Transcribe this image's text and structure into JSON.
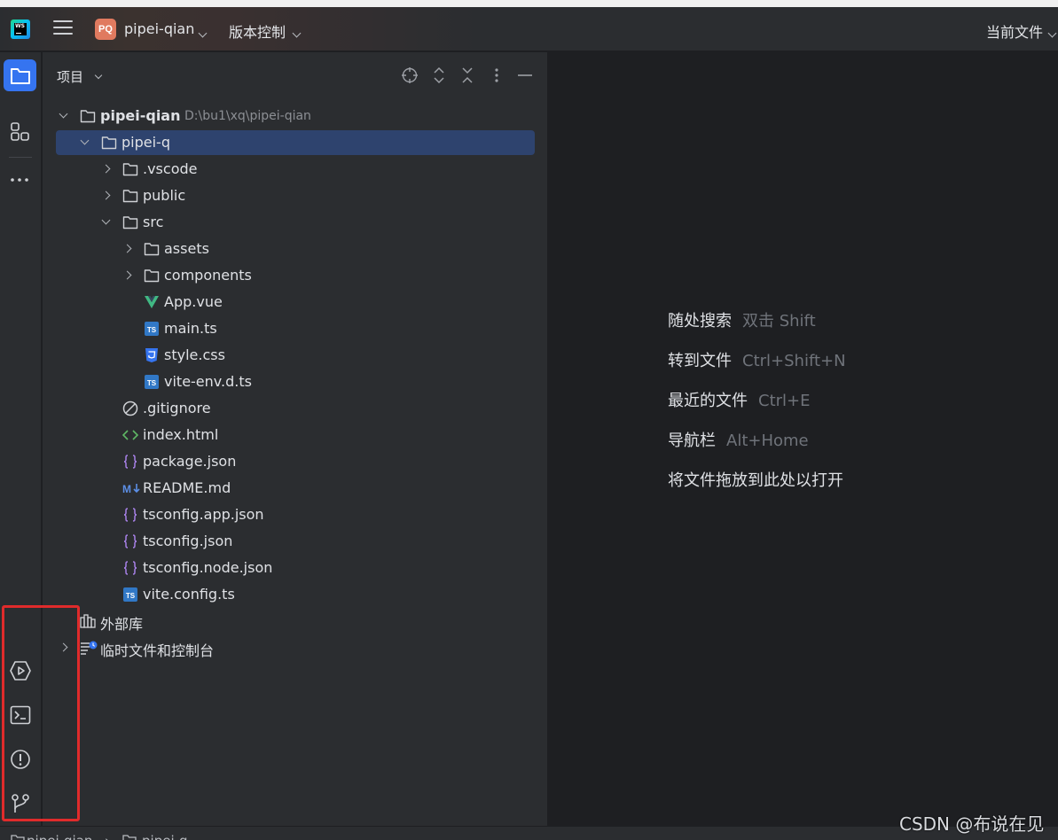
{
  "titlebar": {
    "logo_text": "WS",
    "project_badge": "PQ",
    "project_name": "pipei-qian",
    "vcs_label": "版本控制",
    "current_file_label": "当前文件"
  },
  "panel": {
    "title": "项目"
  },
  "tree": [
    {
      "label": "pipei-qian",
      "path": "D:\\bu1\\xq\\pipei-qian",
      "icon": "folder-icon",
      "depth": 0,
      "arrow": "down",
      "bold": true
    },
    {
      "label": "pipei-q",
      "icon": "folder-icon",
      "depth": 1,
      "arrow": "down",
      "selected": true
    },
    {
      "label": ".vscode",
      "icon": "folder-icon",
      "depth": 2,
      "arrow": "right"
    },
    {
      "label": "public",
      "icon": "folder-icon",
      "depth": 2,
      "arrow": "right"
    },
    {
      "label": "src",
      "icon": "folder-icon",
      "depth": 2,
      "arrow": "down"
    },
    {
      "label": "assets",
      "icon": "folder-icon",
      "depth": 3,
      "arrow": "right"
    },
    {
      "label": "components",
      "icon": "folder-icon",
      "depth": 3,
      "arrow": "right"
    },
    {
      "label": "App.vue",
      "icon": "vue-file-icon",
      "depth": 3
    },
    {
      "label": "main.ts",
      "icon": "typescript-file-icon",
      "depth": 3
    },
    {
      "label": "style.css",
      "icon": "css-file-icon",
      "depth": 3
    },
    {
      "label": "vite-env.d.ts",
      "icon": "typescript-file-icon",
      "depth": 3
    },
    {
      "label": ".gitignore",
      "icon": "ignore-file-icon",
      "depth": 2
    },
    {
      "label": "index.html",
      "icon": "html-file-icon",
      "depth": 2
    },
    {
      "label": "package.json",
      "icon": "json-file-icon",
      "depth": 2
    },
    {
      "label": "README.md",
      "icon": "markdown-file-icon",
      "depth": 2
    },
    {
      "label": "tsconfig.app.json",
      "icon": "json-file-icon",
      "depth": 2
    },
    {
      "label": "tsconfig.json",
      "icon": "json-file-icon",
      "depth": 2
    },
    {
      "label": "tsconfig.node.json",
      "icon": "json-file-icon",
      "depth": 2
    },
    {
      "label": "vite.config.ts",
      "icon": "typescript-file-icon",
      "depth": 2
    },
    {
      "label": "外部库",
      "icon": "library-icon",
      "depth": 0
    },
    {
      "label": "临时文件和控制台",
      "icon": "scratches-icon",
      "depth": 0,
      "arrow": "right"
    }
  ],
  "editor_hints": [
    {
      "label": "随处搜索",
      "shortcut": "双击 Shift"
    },
    {
      "label": "转到文件",
      "shortcut": "Ctrl+Shift+N"
    },
    {
      "label": "最近的文件",
      "shortcut": "Ctrl+E"
    },
    {
      "label": "导航栏",
      "shortcut": "Alt+Home"
    },
    {
      "label": "将文件拖放到此处以打开",
      "shortcut": ""
    }
  ],
  "statusbar": {
    "crumb_root": "pipei-qian",
    "crumb_child": "pipei-q"
  },
  "watermark": "CSDN @布说在见",
  "colors": {
    "accent": "#3574f0",
    "selection": "#2e436e",
    "highlight_box": "#e02b2b"
  }
}
